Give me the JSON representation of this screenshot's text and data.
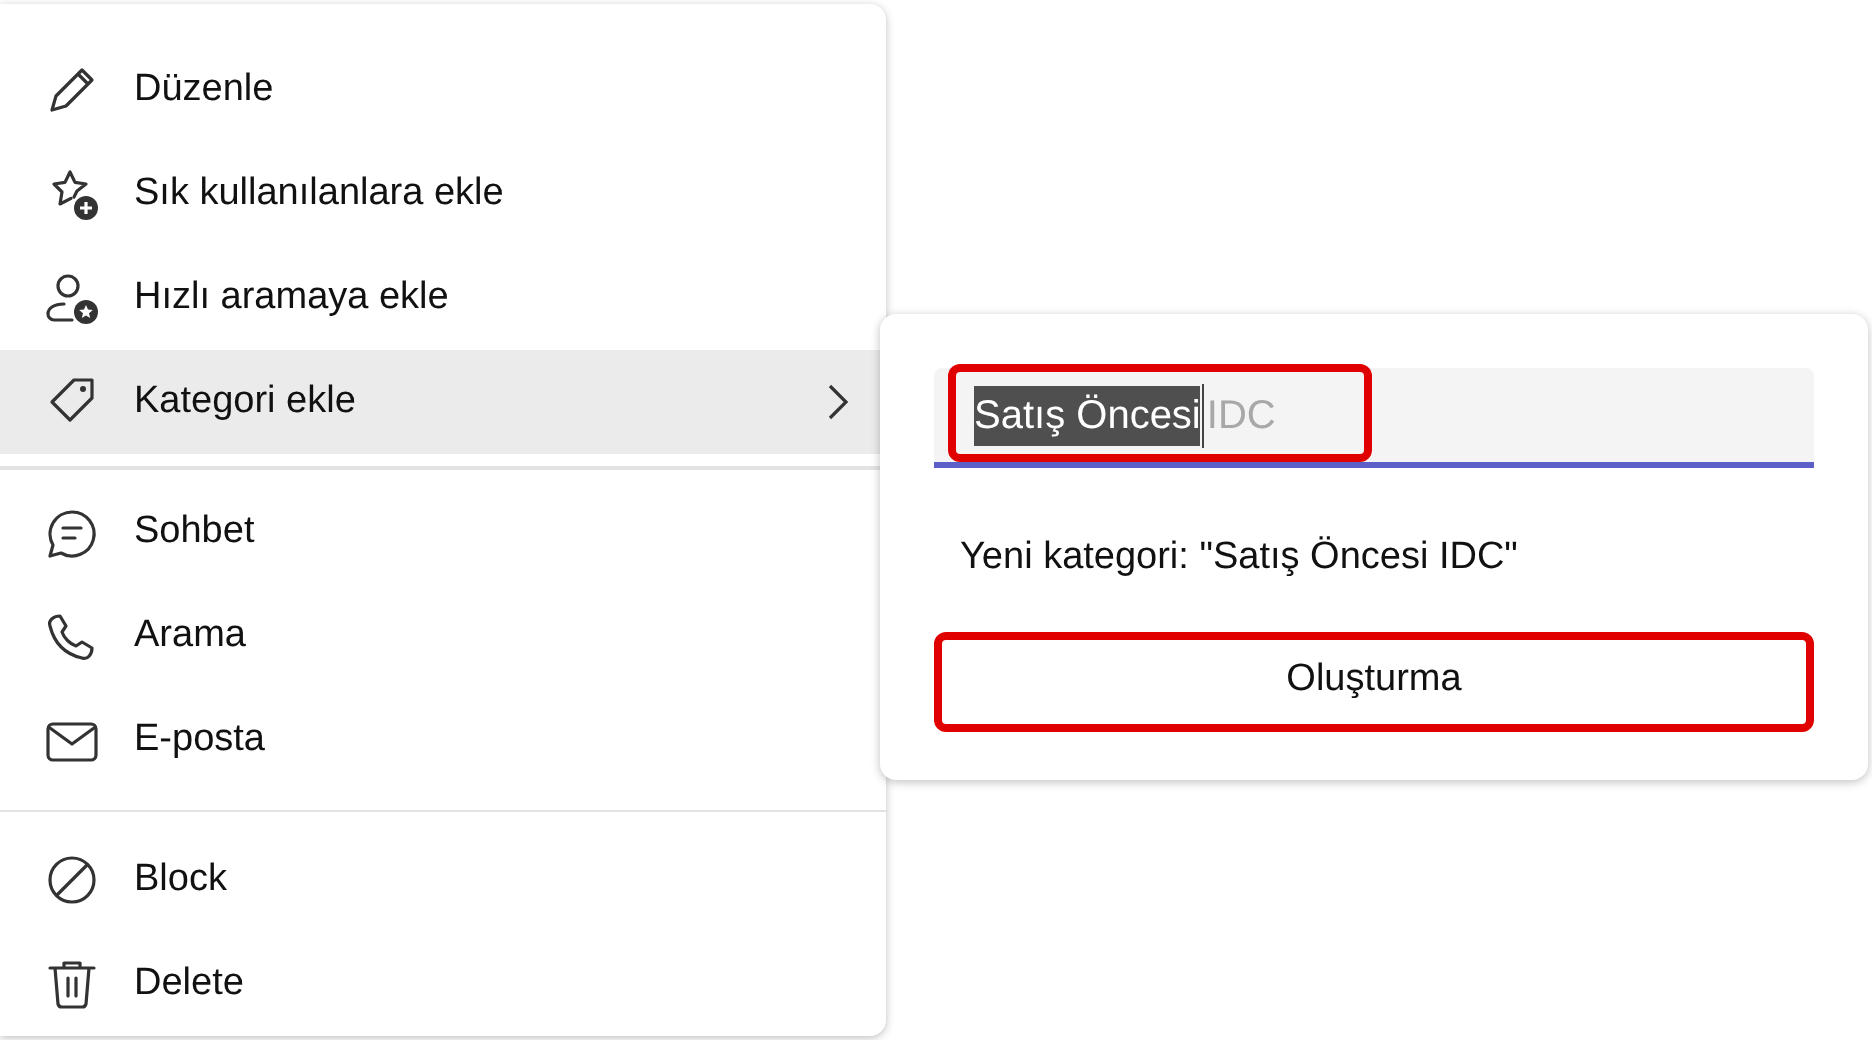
{
  "context_menu": {
    "groups": [
      {
        "items": [
          {
            "label": "Düzenle",
            "selected": false,
            "submenu": false
          },
          {
            "label": "Sık kullanılanlara ekle",
            "selected": false,
            "submenu": false
          },
          {
            "label": "Hızlı aramaya ekle",
            "selected": false,
            "submenu": false
          },
          {
            "label": "Kategori ekle",
            "selected": true,
            "submenu": true
          }
        ]
      },
      {
        "items": [
          {
            "label": "Sohbet",
            "selected": false,
            "submenu": false
          },
          {
            "label": "Arama",
            "selected": false,
            "submenu": false
          },
          {
            "label": "E-posta",
            "selected": false,
            "submenu": false
          }
        ]
      },
      {
        "items": [
          {
            "label": "Block",
            "selected": false,
            "submenu": false
          },
          {
            "label": "Delete",
            "selected": false,
            "submenu": false
          }
        ]
      }
    ]
  },
  "category_popup": {
    "field": {
      "selected_text": "Satış Öncesi",
      "value_rest": "IDC",
      "highlighted": true
    },
    "hint": "Yeni kategori: \"Satış Öncesi IDC\"",
    "create_button": {
      "label": "Oluşturma",
      "highlighted": true
    }
  }
}
